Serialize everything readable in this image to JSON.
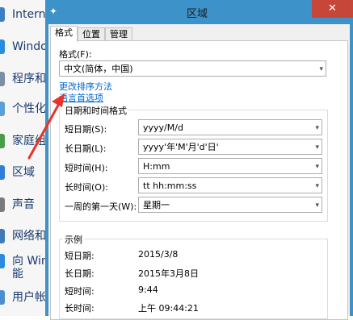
{
  "sidebar": {
    "items": [
      {
        "label": "Intern",
        "icon": "internet-icon",
        "color": "#3b7fc4"
      },
      {
        "label": "Windo",
        "icon": "windows-icon",
        "color": "#2a8be0"
      },
      {
        "label": "程序和",
        "icon": "programs-icon",
        "color": "#7a8fa3"
      },
      {
        "label": "个性化",
        "icon": "personalization-icon",
        "color": "#5aa0d8"
      },
      {
        "label": "家庭组",
        "icon": "homegroup-icon",
        "color": "#4a9d48"
      },
      {
        "label": "区域",
        "icon": "region-icon",
        "color": "#2f7ed8"
      },
      {
        "label": "声音",
        "icon": "sound-icon",
        "color": "#7a7a7a"
      },
      {
        "label": "网络和",
        "icon": "network-icon",
        "color": "#3e7ab8"
      },
      {
        "label": "向 Win",
        "icon": "windows-upgrade-icon",
        "color": "#2a8be0"
      },
      {
        "label": "能",
        "icon": "",
        "color": ""
      },
      {
        "label": "用户帐",
        "icon": "user-accounts-icon",
        "color": "#4a8fd0"
      }
    ]
  },
  "window": {
    "title": "区域",
    "close_label": "✕",
    "tabs": [
      {
        "label": "格式",
        "active": true
      },
      {
        "label": "位置",
        "active": false
      },
      {
        "label": "管理",
        "active": false
      }
    ],
    "format_label": "格式(F):",
    "format_value": "中文(简体，中国)",
    "sort_link": "更改排序方法",
    "lang_link": "语言首选项",
    "datetime_group_title": "日期和时间格式",
    "rows": [
      {
        "label": "短日期(S):",
        "value": "yyyy/M/d"
      },
      {
        "label": "长日期(L):",
        "value": "yyyy'年'M'月'd'日'"
      },
      {
        "label": "短时间(H):",
        "value": "H:mm"
      },
      {
        "label": "长时间(O):",
        "value": "tt hh:mm:ss"
      },
      {
        "label": "一周的第一天(W):",
        "value": "星期一"
      }
    ],
    "example_group_title": "示例",
    "examples": [
      {
        "label": "短日期:",
        "value": "2015/3/8"
      },
      {
        "label": "长日期:",
        "value": "2015年3月8日"
      },
      {
        "label": "短时间:",
        "value": "9:44"
      },
      {
        "label": "长时间:",
        "value": "上午 09:44:21"
      }
    ]
  },
  "colors": {
    "window_frame": "#3d92c9",
    "close_button": "#c7463a",
    "link": "#0066cc",
    "annotation_arrow": "#e8332a"
  }
}
